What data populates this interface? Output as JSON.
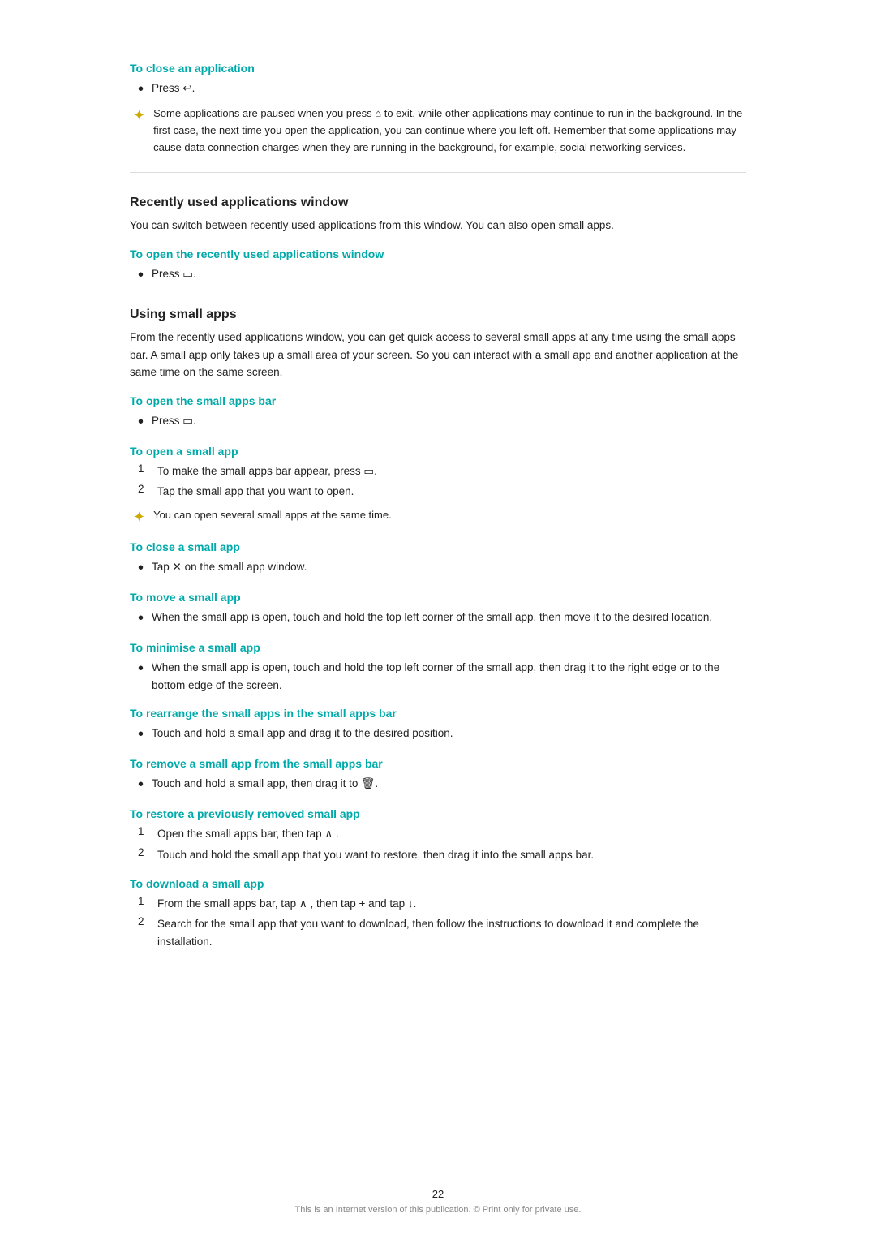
{
  "page": {
    "page_number": "22",
    "footer_text": "This is an Internet version of this publication. © Print only for private use."
  },
  "sections": {
    "close_application": {
      "heading": "To close an application",
      "bullet": "Press ↩.",
      "tip": "Some applications are paused when you press ⌂ to exit, while other applications may continue to run in the background. In the first case, the next time you open the application, you can continue where you left off. Remember that some applications may cause data connection charges when they are running in the background, for example, social networking services."
    },
    "recently_used": {
      "heading": "Recently used applications window",
      "description": "You can switch between recently used applications from this window. You can also open small apps.",
      "open_heading": "To open the recently used applications window",
      "open_bullet": "Press ▭."
    },
    "using_small_apps": {
      "heading": "Using small apps",
      "description": "From the recently used applications window, you can get quick access to several small apps at any time using the small apps bar. A small app only takes up a small area of your screen. So you can interact with a small app and another application at the same time on the same screen.",
      "open_bar": {
        "heading": "To open the small apps bar",
        "bullet": "Press ▭."
      },
      "open_app": {
        "heading": "To open a small app",
        "steps": [
          "To make the small apps bar appear, press ▭.",
          "Tap the small app that you want to open."
        ],
        "tip": "You can open several small apps at the same time."
      },
      "close_app": {
        "heading": "To close a small app",
        "bullet": "Tap ✕ on the small app window."
      },
      "move_app": {
        "heading": "To move a small app",
        "bullet": "When the small app is open, touch and hold the top left corner of the small app, then move it to the desired location."
      },
      "minimise_app": {
        "heading": "To minimise a small app",
        "bullet": "When the small app is open, touch and hold the top left corner of the small app, then drag it to the right edge or to the bottom edge of the screen."
      },
      "rearrange_apps": {
        "heading": "To rearrange the small apps in the small apps bar",
        "bullet": "Touch and hold a small app and drag it to the desired position."
      },
      "remove_app": {
        "heading": "To remove a small app from the small apps bar",
        "bullet": "Touch and hold a small app, then drag it to 🗑."
      },
      "restore_app": {
        "heading": "To restore a previously removed small app",
        "steps": [
          "Open the small apps bar, then tap ∧ .",
          "Touch and hold the small app that you want to restore, then drag it into the small apps bar."
        ]
      },
      "download_app": {
        "heading": "To download a small app",
        "steps": [
          "From the small apps bar, tap ∧ , then tap + and tap ↓.",
          "Search for the small app that you want to download, then follow the instructions to download it and complete the installation."
        ]
      }
    }
  }
}
